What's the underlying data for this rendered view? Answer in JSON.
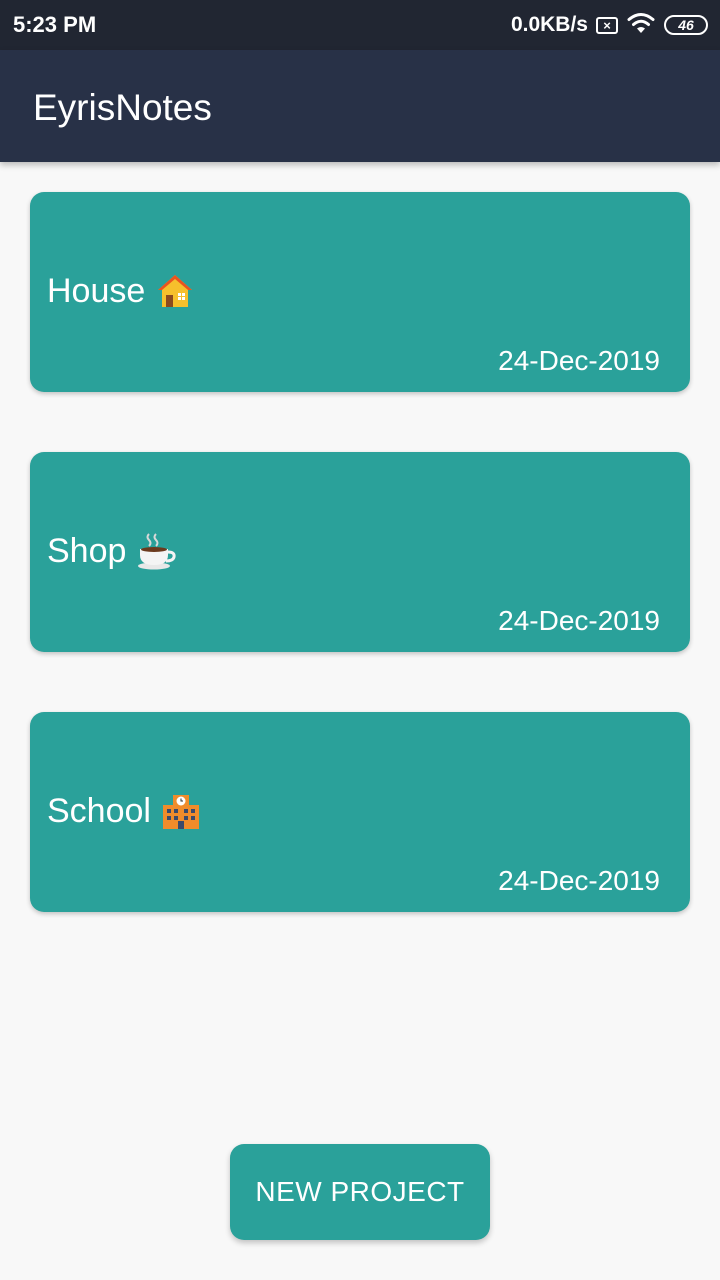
{
  "status_bar": {
    "time": "5:23 PM",
    "net_speed": "0.0KB/s",
    "sim_icon_glyph": "×",
    "battery": "46"
  },
  "app_bar": {
    "title": "EyrisNotes"
  },
  "notes": [
    {
      "title": "House",
      "icon": "house-icon",
      "date": "24-Dec-2019"
    },
    {
      "title": "Shop",
      "icon": "coffee-cup-icon",
      "date": "24-Dec-2019"
    },
    {
      "title": "School",
      "icon": "school-building-icon",
      "date": "24-Dec-2019"
    }
  ],
  "new_project_label": "NEW PROJECT",
  "colors": {
    "status_bar_bg": "#212632",
    "app_bar_bg": "#283147",
    "card_bg": "#2aa19a",
    "page_bg": "#f8f8f8"
  }
}
